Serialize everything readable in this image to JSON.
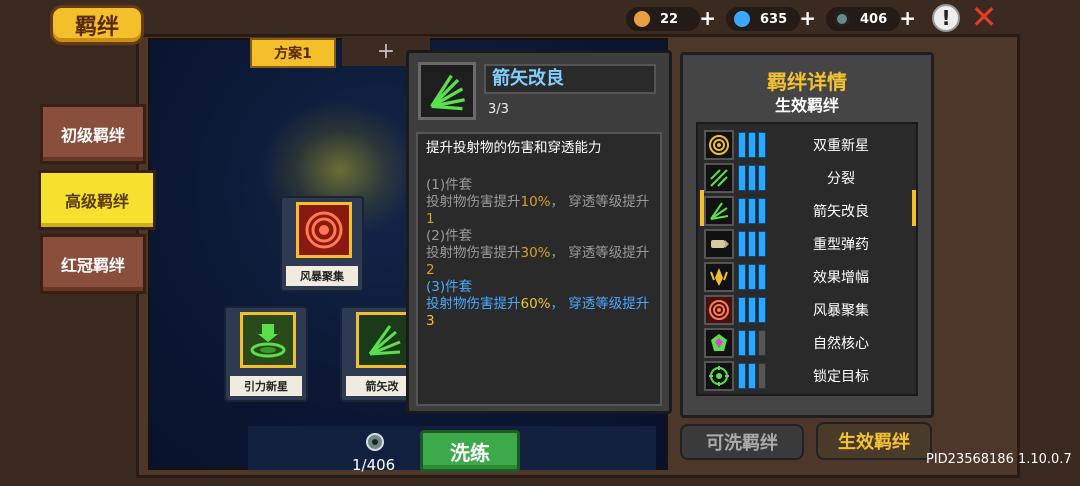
{
  "header": {
    "title": "羁绊"
  },
  "resources": [
    {
      "value": "22",
      "icon": "fist-icon",
      "color": "#e8a040"
    },
    {
      "value": "635",
      "icon": "gem-icon",
      "color": "#3aa8ff"
    },
    {
      "value": "406",
      "icon": "orb-icon",
      "color": "#6a8a8a"
    }
  ],
  "plus_label": "+",
  "alert_label": "!",
  "close_label": "✕",
  "side_tabs": [
    {
      "label": "初级羁绊",
      "active": false
    },
    {
      "label": "高级羁绊",
      "active": true
    },
    {
      "label": "红冠羁绊",
      "active": false
    }
  ],
  "scheme": {
    "tab_label": "方案1",
    "add_label": "+"
  },
  "nodes": [
    {
      "label": "风暴聚集",
      "icon": "target-rings-icon"
    },
    {
      "label": "引力新星",
      "icon": "nova-icon"
    },
    {
      "label": "箭矢改",
      "icon": "arrows-icon"
    }
  ],
  "popup": {
    "name": "箭矢改良",
    "level": "3/3",
    "description": "提升投射物的伤害和穿透能力",
    "tiers": [
      {
        "header": "(1)件套",
        "text_a": "投射物伤害提升",
        "pct": "10%",
        "text_b": "， 穿透等级提升",
        "lvl": "1",
        "active": false
      },
      {
        "header": "(2)件套",
        "text_a": "投射物伤害提升",
        "pct": "30%",
        "text_b": "， 穿透等级提升",
        "lvl": "2",
        "active": false
      },
      {
        "header": "(3)件套",
        "text_a": "投射物伤害提升",
        "pct": "60%",
        "text_b": "， 穿透等级提升",
        "lvl": "3",
        "active": true
      }
    ]
  },
  "details": {
    "title": "羁绊详情",
    "subtitle": "生效羁绊",
    "bonds": [
      {
        "name": "双重新星",
        "icon": "double-nova-icon",
        "pips": 3
      },
      {
        "name": "分裂",
        "icon": "split-icon",
        "pips": 3
      },
      {
        "name": "箭矢改良",
        "icon": "arrows-icon",
        "pips": 3,
        "selected": true
      },
      {
        "name": "重型弹药",
        "icon": "bullet-icon",
        "pips": 3
      },
      {
        "name": "效果增幅",
        "icon": "amplify-icon",
        "pips": 3
      },
      {
        "name": "风暴聚集",
        "icon": "target-rings-icon",
        "pips": 3
      },
      {
        "name": "自然核心",
        "icon": "nature-core-icon",
        "pips": 2
      },
      {
        "name": "锁定目标",
        "icon": "crosshair-icon",
        "pips": 2
      }
    ]
  },
  "bottom_tabs": {
    "washable": "可洗羁绊",
    "active": "生效羁绊"
  },
  "refine": {
    "count": "1/406",
    "button": "洗练"
  },
  "build_id": "PID23568186 1.10.0.7"
}
